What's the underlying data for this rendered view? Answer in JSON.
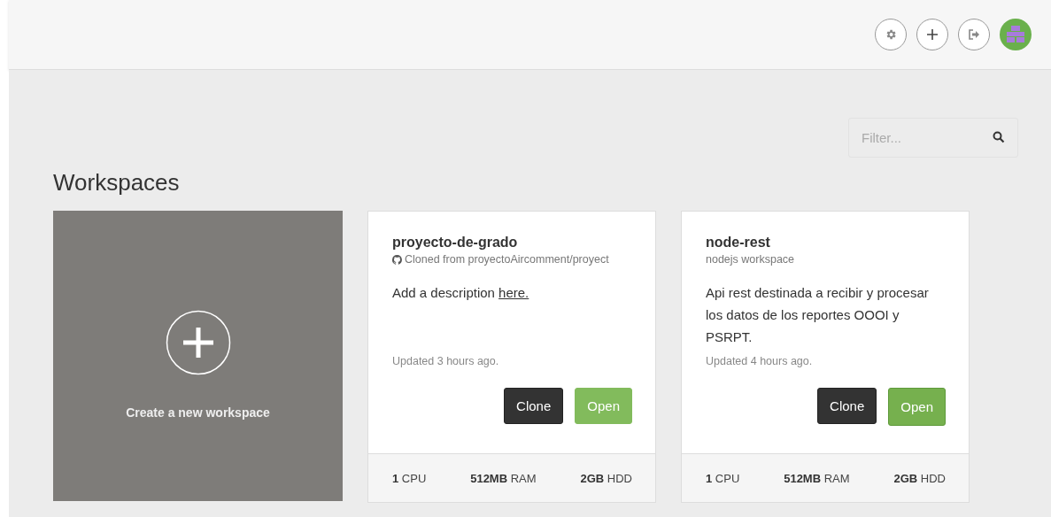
{
  "header": {
    "actions": [
      {
        "kind": "settings"
      },
      {
        "kind": "add"
      },
      {
        "kind": "logout"
      },
      {
        "kind": "avatar"
      }
    ]
  },
  "filter": {
    "placeholder": "Filter..."
  },
  "title": "Workspaces",
  "create_card": {
    "label": "Create a new workspace"
  },
  "workspaces": [
    {
      "name": "proyecto-de-grado",
      "source": "Cloned from proyectoAircomment/proyect",
      "github_icon": true,
      "description": "Add a description ",
      "description_link": "here.",
      "updated": "Updated 3 hours ago.",
      "clone_label": "Clone",
      "open_label": "Open",
      "open_hovered": false,
      "resources": [
        "**1** CPU",
        "**512MB** RAM",
        "**2GB** HDD"
      ]
    },
    {
      "name": "node-rest",
      "source": "nodejs workspace",
      "github_icon": false,
      "description": "Api rest destinada a recibir y procesar los datos de los reportes OOOI y PSRPT.",
      "updated": "Updated 4 hours ago.",
      "clone_label": "Clone",
      "open_label": "Open",
      "open_hovered": true,
      "resources": [
        "**1** CPU",
        "**512MB** RAM",
        "**2GB** HDD"
      ]
    }
  ]
}
